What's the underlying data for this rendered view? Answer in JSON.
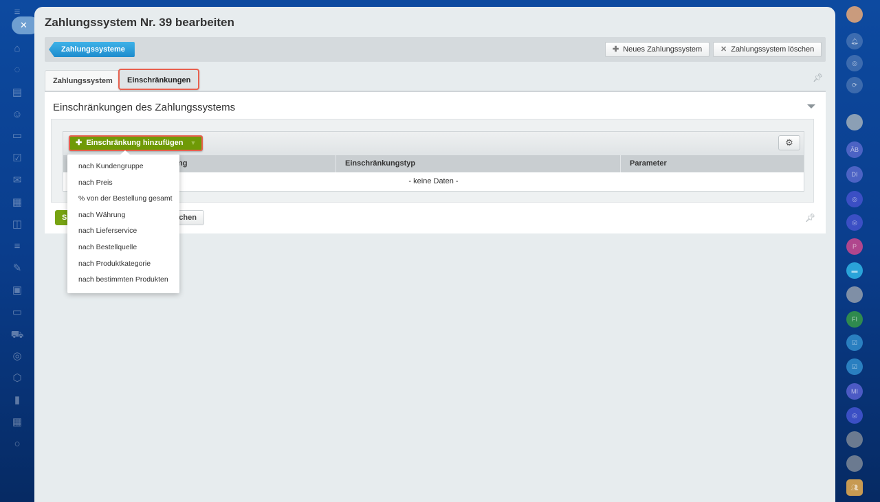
{
  "page": {
    "title": "Zahlungssystem Nr. 39 bearbeiten"
  },
  "toolbar": {
    "breadcrumb": "Zahlungssysteme",
    "new_label": "Neues Zahlungssystem",
    "delete_label": "Zahlungssystem löschen"
  },
  "tabs": [
    {
      "label": "Zahlungssystem"
    },
    {
      "label": "Einschränkungen"
    }
  ],
  "section": {
    "title": "Einschränkungen des Zahlungssystems"
  },
  "grid": {
    "add_label": "Einschränkung hinzufügen",
    "columns": [
      "rung",
      "Einschränkungstyp",
      "Parameter"
    ],
    "empty": "- keine Daten -"
  },
  "menu": [
    "nach Kundengruppe",
    "nach Preis",
    "% von der Bestellung gesamt",
    "nach Währung",
    "nach Lieferservice",
    "nach Bestellquelle",
    "nach Produktkategorie",
    "nach bestimmten Produkten"
  ],
  "footer": {
    "save_label": "Speichern",
    "cancel_label": "Abbrechen"
  },
  "right_bar": {
    "avatars": [
      "ÄB",
      "DI",
      "P",
      "FI",
      "MI"
    ]
  }
}
